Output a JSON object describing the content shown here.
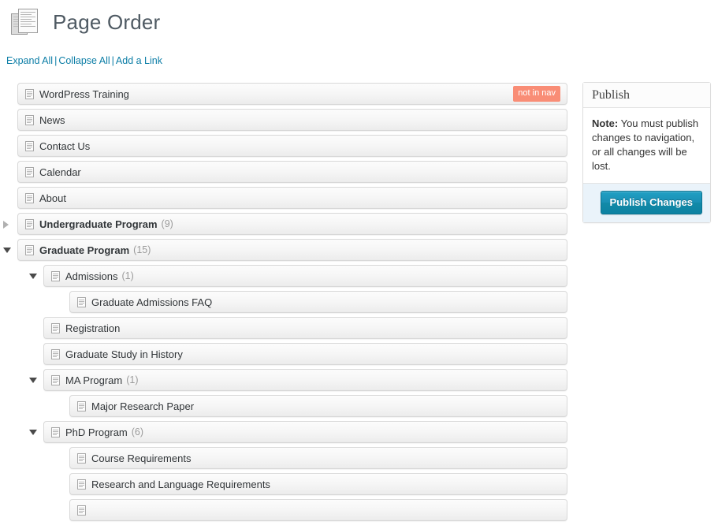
{
  "header": {
    "title": "Page Order",
    "icon": "documents-stack-icon"
  },
  "action_links": {
    "expand_all": "Expand All",
    "collapse_all": "Collapse All",
    "add_a_link": "Add a Link",
    "separator": "|"
  },
  "colors": {
    "link": "#0b7da6",
    "badge_not_in_nav": "#f98d76",
    "publish_button": "#1a8fb4",
    "title": "#4f5a63"
  },
  "tree": {
    "rows": [
      {
        "label": "WordPress Training",
        "level": 0,
        "bold": false,
        "count": null,
        "toggle": "none",
        "badge": "not in nav"
      },
      {
        "label": "News",
        "level": 0,
        "bold": false,
        "count": null,
        "toggle": "none",
        "badge": null
      },
      {
        "label": "Contact Us",
        "level": 0,
        "bold": false,
        "count": null,
        "toggle": "none",
        "badge": null
      },
      {
        "label": "Calendar",
        "level": 0,
        "bold": false,
        "count": null,
        "toggle": "none",
        "badge": null
      },
      {
        "label": "About",
        "level": 0,
        "bold": false,
        "count": null,
        "toggle": "none",
        "badge": null
      },
      {
        "label": "Undergraduate Program",
        "level": 0,
        "bold": true,
        "count": "(9)",
        "toggle": "collapsed",
        "badge": null
      },
      {
        "label": "Graduate Program",
        "level": 0,
        "bold": true,
        "count": "(15)",
        "toggle": "expanded",
        "badge": null
      },
      {
        "label": "Admissions",
        "level": 1,
        "bold": false,
        "count": "(1)",
        "toggle": "expanded",
        "badge": null
      },
      {
        "label": "Graduate Admissions FAQ",
        "level": 2,
        "bold": false,
        "count": null,
        "toggle": "none",
        "badge": null
      },
      {
        "label": "Registration",
        "level": 1,
        "bold": false,
        "count": null,
        "toggle": "none",
        "badge": null
      },
      {
        "label": "Graduate Study in History",
        "level": 1,
        "bold": false,
        "count": null,
        "toggle": "none",
        "badge": null
      },
      {
        "label": "MA Program",
        "level": 1,
        "bold": false,
        "count": "(1)",
        "toggle": "expanded",
        "badge": null
      },
      {
        "label": "Major Research Paper",
        "level": 2,
        "bold": false,
        "count": null,
        "toggle": "none",
        "badge": null
      },
      {
        "label": "PhD Program",
        "level": 1,
        "bold": false,
        "count": "(6)",
        "toggle": "expanded",
        "badge": null
      },
      {
        "label": "Course Requirements",
        "level": 2,
        "bold": false,
        "count": null,
        "toggle": "none",
        "badge": null
      },
      {
        "label": "Research and Language Requirements",
        "level": 2,
        "bold": false,
        "count": null,
        "toggle": "none",
        "badge": null
      },
      {
        "label": "",
        "level": 2,
        "bold": false,
        "count": null,
        "toggle": "none",
        "badge": null
      }
    ]
  },
  "publish_panel": {
    "title": "Publish",
    "note_label": "Note:",
    "note_text": " You must publish changes to navigation, or all changes will be lost.",
    "button_label": "Publish Changes"
  }
}
